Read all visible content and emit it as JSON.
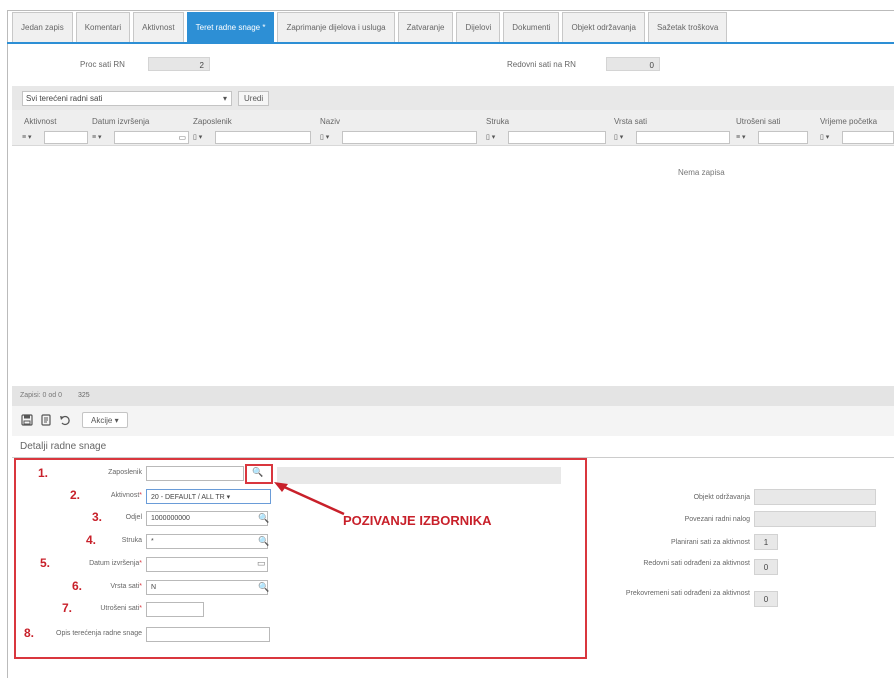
{
  "tabs": [
    "Jedan zapis",
    "Komentari",
    "Aktivnost",
    "Teret radne snage *",
    "Zaprimanje dijelova i usluga",
    "Zatvaranje",
    "Dijelovi",
    "Dokumenti",
    "Objekt održavanja",
    "Sažetak troškova"
  ],
  "header": {
    "proc_label": "Proc sati RN",
    "proc_value": "2",
    "redovni_label": "Redovni sati na RN",
    "redovni_value": "0"
  },
  "filter": {
    "dropdown_value": "Svi terećeni radni sati",
    "dropdown_caret": "▾",
    "run_button": "Uredi"
  },
  "grid": {
    "columns": [
      "Aktivnost",
      "Datum izvršenja",
      "Zaposlenik",
      "Naziv",
      "Struka",
      "Vrsta sati",
      "Utrošeni sati",
      "Vrijeme početka"
    ],
    "filter_ops": [
      "≡ ▾",
      "≡ ▾",
      "▯ ▾",
      "▯ ▾",
      "▯ ▾",
      "▯ ▾",
      "≡ ▾",
      "▯ ▾"
    ],
    "calendar_icon": "▭",
    "empty_text": "Nema zapisa"
  },
  "pager": {
    "text": "Zapisi: 0 od 0",
    "extra": "325"
  },
  "toolbar": {
    "akcije_label": "Akcije ▾"
  },
  "section": {
    "title": "Detalji radne snage"
  },
  "form": {
    "annotation": "POZIVANJE IZBORNIKA",
    "fields": [
      {
        "num": "1.",
        "label": "Zaposlenik",
        "required": "",
        "value": ""
      },
      {
        "num": "2.",
        "label": "Aktivnost",
        "required": "*",
        "value": "20 - DEFAULT / ALL TR ▾"
      },
      {
        "num": "3.",
        "label": "Odjel",
        "required": "",
        "value": "1000000000"
      },
      {
        "num": "4.",
        "label": "Struka",
        "required": "",
        "value": "*"
      },
      {
        "num": "5.",
        "label": "Datum izvršenja",
        "required": "*",
        "value": ""
      },
      {
        "num": "6.",
        "label": "Vrsta sati",
        "required": "*",
        "value": "N"
      },
      {
        "num": "7.",
        "label": "Utrošeni sati",
        "required": "*",
        "value": ""
      },
      {
        "num": "8.",
        "label": "Opis terećenja radne snage",
        "required": "",
        "value": ""
      }
    ]
  },
  "right_panel": {
    "objekt_label": "Objekt održavanja",
    "povezani_label": "Povezani radni nalog",
    "planirani_label": "Planirani sati za aktivnost",
    "planirani_value": "1",
    "redovni_label": "Redovni sati odrađeni za aktivnost",
    "redovni_value": "0",
    "prekovremeni_label": "Prekovremeni sati odrađeni za aktivnost",
    "prekovremeni_value": "0"
  },
  "icons": {
    "save": "save-icon",
    "copy": "copy-icon",
    "undo": "undo-icon",
    "lookup": "magnifier-icon",
    "calendar": "calendar-icon"
  }
}
